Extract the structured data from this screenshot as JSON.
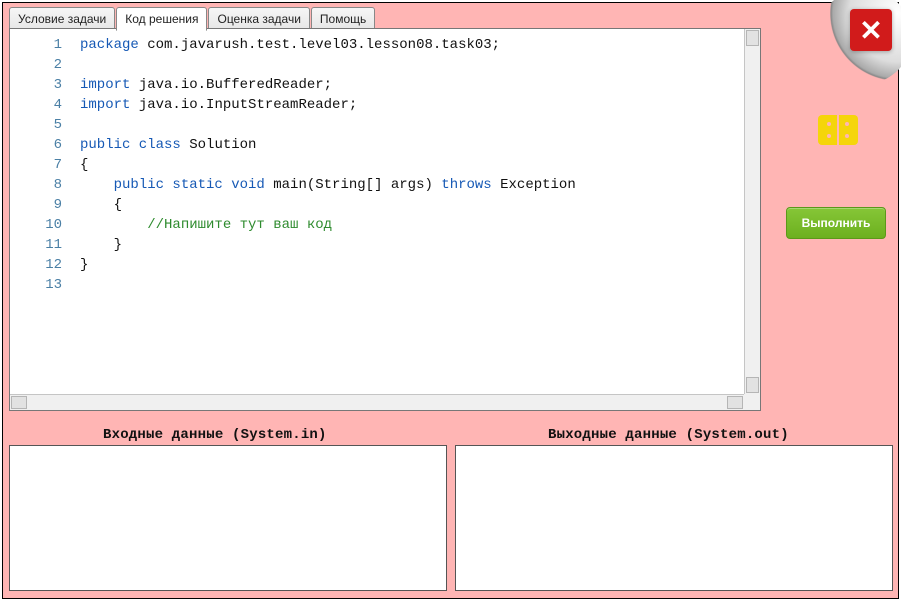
{
  "tabs": [
    {
      "label": "Условие задачи",
      "active": false
    },
    {
      "label": "Код решения",
      "active": true
    },
    {
      "label": "Оценка задачи",
      "active": false
    },
    {
      "label": "Помощь",
      "active": false
    }
  ],
  "editor": {
    "line_count": 13,
    "code_lines": [
      {
        "k": "pkg",
        "tokens": [
          [
            "kw",
            "package"
          ],
          [
            "sp",
            " "
          ],
          [
            "name",
            "com.javarush.test.level03.lesson08.task03;"
          ]
        ]
      },
      {
        "k": "blank"
      },
      {
        "k": "imp",
        "tokens": [
          [
            "kw",
            "import"
          ],
          [
            "sp",
            " "
          ],
          [
            "name",
            "java.io.BufferedReader;"
          ]
        ]
      },
      {
        "k": "imp",
        "tokens": [
          [
            "kw",
            "import"
          ],
          [
            "sp",
            " "
          ],
          [
            "name",
            "java.io.InputStreamReader;"
          ]
        ]
      },
      {
        "k": "blank"
      },
      {
        "k": "cls",
        "tokens": [
          [
            "kw",
            "public class"
          ],
          [
            "sp",
            " "
          ],
          [
            "name",
            "Solution"
          ]
        ]
      },
      {
        "k": "txt",
        "text": "{"
      },
      {
        "k": "mth",
        "indent": 1,
        "tokens": [
          [
            "kw",
            "public static void"
          ],
          [
            "sp",
            " "
          ],
          [
            "name",
            "main(String[] args)"
          ],
          [
            "sp",
            " "
          ],
          [
            "kw",
            "throws"
          ],
          [
            "sp",
            " "
          ],
          [
            "name",
            "Exception"
          ]
        ]
      },
      {
        "k": "txt",
        "indent": 1,
        "text": "{"
      },
      {
        "k": "cm",
        "indent": 2,
        "text": "//Напишите тут ваш код"
      },
      {
        "k": "txt",
        "indent": 1,
        "text": "}"
      },
      {
        "k": "txt",
        "text": "}"
      },
      {
        "k": "blank"
      }
    ]
  },
  "run_button_label": "Выполнить",
  "close_label": "✕",
  "io": {
    "input_label": "Входные данные (System.in)",
    "output_label": "Выходные данные (System.out)",
    "input_value": "",
    "output_value": ""
  }
}
